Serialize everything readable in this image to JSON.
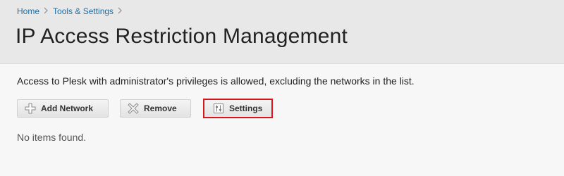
{
  "breadcrumb": {
    "items": [
      {
        "label": "Home"
      },
      {
        "label": "Tools & Settings"
      }
    ],
    "separator": ">"
  },
  "page": {
    "title": "IP Access Restriction Management",
    "description": "Access to Plesk with administrator's privileges is allowed, excluding the networks in the list."
  },
  "toolbar": {
    "add_label": "Add Network",
    "remove_label": "Remove",
    "settings_label": "Settings"
  },
  "list": {
    "empty_message": "No items found."
  },
  "colors": {
    "link": "#1c6ea4",
    "highlight": "#d9151f",
    "header_bg": "#e8e8e8"
  },
  "icons": {
    "add": "plus-icon",
    "remove": "x-icon",
    "settings": "settings-icon",
    "separator": "chevron-right-icon"
  }
}
